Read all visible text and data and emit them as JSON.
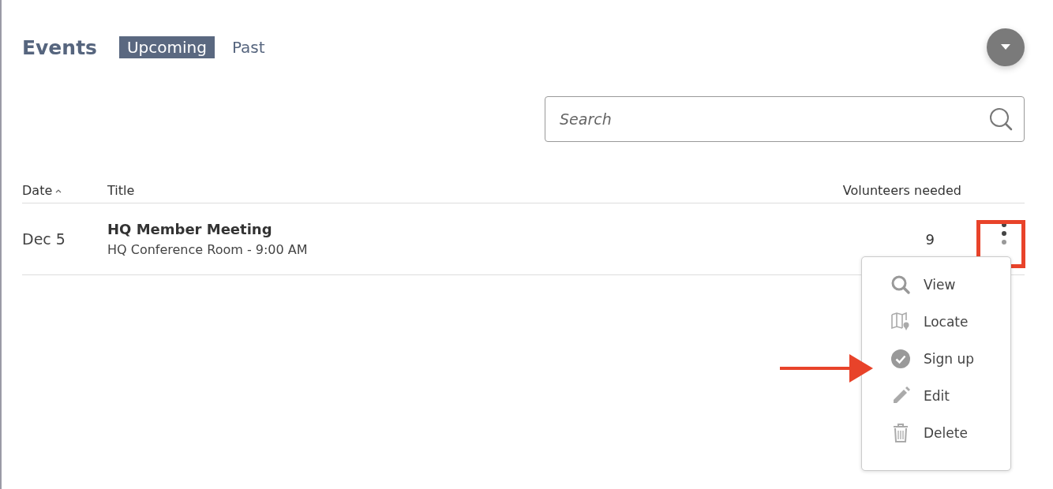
{
  "header": {
    "title": "Events"
  },
  "tabs": [
    {
      "label": "Upcoming",
      "selected": true
    },
    {
      "label": "Past",
      "selected": false
    }
  ],
  "search": {
    "placeholder": "Search"
  },
  "table": {
    "columns": [
      {
        "label": "Date",
        "sorted": true
      },
      {
        "label": "Title",
        "sorted": false
      },
      {
        "label": "Volunteers needed",
        "sorted": false
      }
    ],
    "rows": [
      {
        "date": "Dec 5",
        "title": "HQ Member Meeting",
        "subtitle": "HQ Conference Room - 9:00 AM",
        "volunteers": "9"
      }
    ]
  },
  "menu": {
    "items": [
      {
        "label": "View",
        "kind": "view"
      },
      {
        "label": "Locate",
        "kind": "locate"
      },
      {
        "label": "Sign up",
        "kind": "signup"
      },
      {
        "label": "Edit",
        "kind": "edit"
      },
      {
        "label": "Delete",
        "kind": "delete"
      }
    ]
  }
}
